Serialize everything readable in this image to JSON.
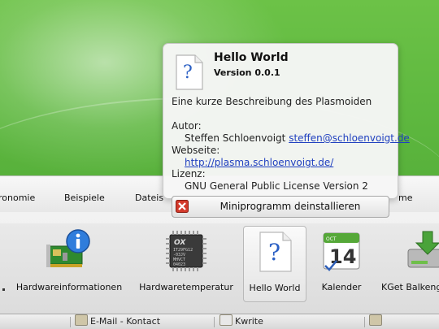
{
  "categories": [
    "ronomie",
    "Beispiele",
    "Dateis",
    "me"
  ],
  "applets": [
    {
      "label": "Hardwareinformationen",
      "icon": "hardware-info-icon"
    },
    {
      "label": "Hardwaretemperatur",
      "icon": "chip-temperature-icon"
    },
    {
      "label": "Hello World",
      "icon": "question-document-icon"
    },
    {
      "label": "Kalender",
      "icon": "calendar-icon",
      "calendar_month": "OCT",
      "calendar_day": "14"
    },
    {
      "label": "KGet Balkeng",
      "icon": "kget-download-icon"
    }
  ],
  "chip_text": {
    "logo": "OX",
    "line1": "IT29FG12",
    "line2": "-03JV",
    "line3": "MHVCT",
    "line4": "04023"
  },
  "tooltip": {
    "title": "Hello World",
    "version": "Version 0.0.1",
    "description": "Eine kurze Beschreibung des Plasmoiden",
    "author_label": "Autor:",
    "author_name": "Steffen Schloenvoigt",
    "author_email": "steffen@schloenvoigt.de",
    "website_label": "Webseite:",
    "website_url": "http://plasma.schloenvoigt.de/",
    "license_label": "Lizenz:",
    "license_name": "GNU General Public License Version 2",
    "uninstall_label": "Miniprogramm deinstallieren",
    "uninstall_icon": "red-x-icon"
  },
  "taskbar": {
    "items": [
      "E-Mail - Kontact",
      "Kwrite"
    ]
  },
  "colors": {
    "desktop_green": "#5cb63e",
    "link_blue": "#1f3fbf",
    "uninstall_red": "#d33a2c"
  }
}
